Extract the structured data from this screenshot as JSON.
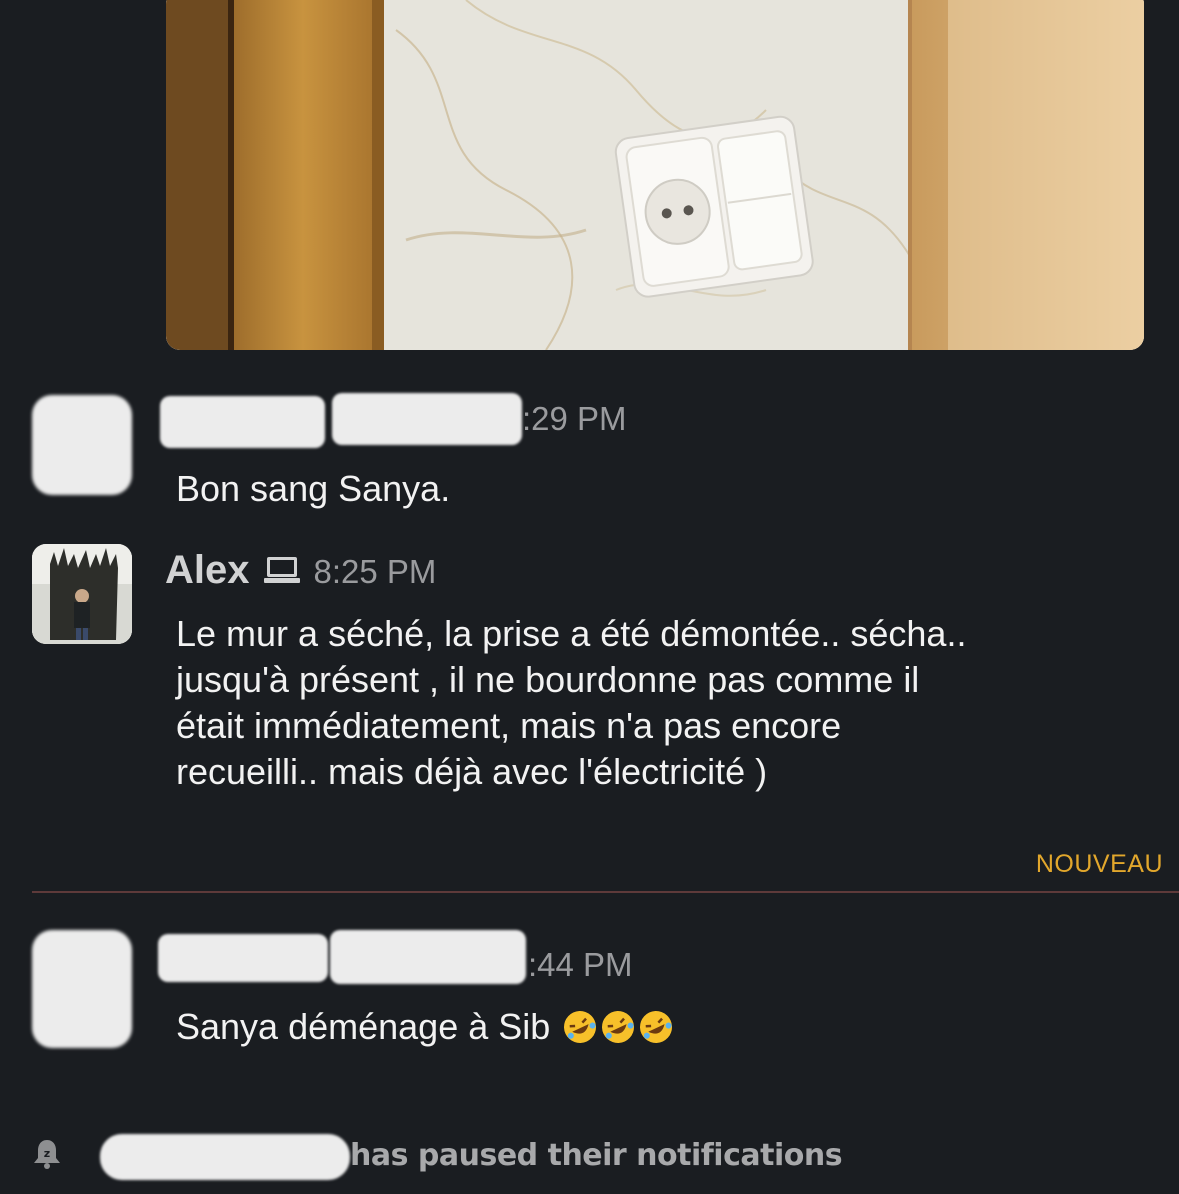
{
  "messages": [
    {
      "author": "",
      "time": ":29 PM",
      "text": "Bon sang Sanya."
    },
    {
      "author": "Alex",
      "time": "8:25 PM",
      "text_lines": [
        "Le mur a séché, la prise a été démontée.. sécha..",
        "jusqu'à présent , il ne bourdonne pas comme il",
        "était immédiatement, mais n'a pas encore",
        "recueilli.. mais déjà avec l'électricité )"
      ]
    },
    {
      "author": "",
      "time": ":44 PM",
      "text": "Sanya déménage à Sib",
      "emoji": "rofl"
    }
  ],
  "divider": {
    "label": "NOUVEAU",
    "color": "#e2a72c"
  },
  "notification": {
    "icon": "bell-paused-icon",
    "text": "has paused their notifications"
  },
  "colors": {
    "background": "#1a1d21",
    "text": "#f2f2f2",
    "muted": "#9a9b9e"
  }
}
